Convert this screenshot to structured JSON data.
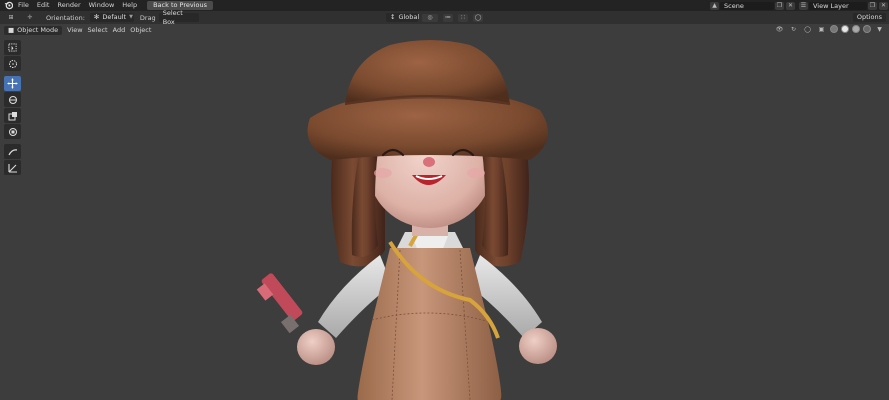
{
  "menubar": {
    "items": [
      "File",
      "Edit",
      "Render",
      "Window",
      "Help"
    ],
    "back_label": "Back to Previous",
    "scene_value": "Scene",
    "view_layer_value": "View Layer"
  },
  "toolheader": {
    "orientation_label": "Orientation:",
    "orientation_value": "Default",
    "drag_label": "Drag",
    "drag_value": "Select Box",
    "transform_orientation": "Global",
    "options_label": "Options"
  },
  "viewport_header": {
    "mode": "Object Mode",
    "menus": [
      "View",
      "Select",
      "Add",
      "Object"
    ]
  },
  "toolbar": {
    "tools": [
      "select-box",
      "cursor",
      "move",
      "rotate",
      "scale",
      "transform",
      "annotate",
      "measure"
    ],
    "active": "move"
  },
  "colors": {
    "accent": "#4772b3",
    "background": "#3d3d3d",
    "menubar": "#232323",
    "header": "#303030"
  }
}
